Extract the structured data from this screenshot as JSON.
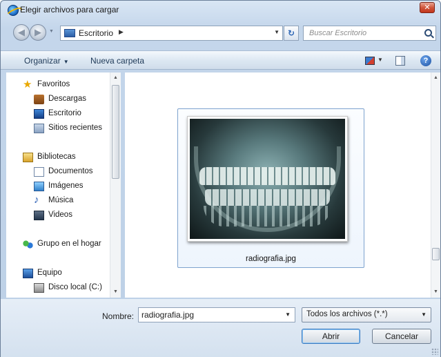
{
  "window": {
    "title": "Elegir archivos para cargar"
  },
  "address": {
    "location": "Escritorio"
  },
  "search": {
    "placeholder": "Buscar Escritorio"
  },
  "toolbar": {
    "organize_label": "Organizar",
    "new_folder_label": "Nueva carpeta"
  },
  "sidebar": {
    "items": [
      {
        "label": "Favoritos",
        "icon": "star-icon"
      },
      {
        "label": "Descargas",
        "icon": "downloads-icon"
      },
      {
        "label": "Escritorio",
        "icon": "desktop-icon"
      },
      {
        "label": "Sitios recientes",
        "icon": "recent-places-icon"
      },
      {
        "label": "Bibliotecas",
        "icon": "libraries-icon"
      },
      {
        "label": "Documentos",
        "icon": "documents-icon"
      },
      {
        "label": "Imágenes",
        "icon": "pictures-icon"
      },
      {
        "label": "Música",
        "icon": "music-icon"
      },
      {
        "label": "Videos",
        "icon": "videos-icon"
      },
      {
        "label": "Grupo en el hogar",
        "icon": "homegroup-icon"
      },
      {
        "label": "Equipo",
        "icon": "computer-icon"
      },
      {
        "label": "Disco local (C:)",
        "icon": "disk-icon"
      }
    ]
  },
  "files": [
    {
      "name": "radiografia.jpg",
      "icon": "xray-image-thumbnail"
    }
  ],
  "footer": {
    "filename_label": "Nombre:",
    "filename_value": "radiografia.jpg",
    "filter_value": "Todos los archivos (*.*)",
    "open_label": "Abrir",
    "cancel_label": "Cancelar"
  },
  "colors": {
    "close_button": "#c2361b",
    "selection_border": "#7da2ce",
    "accent": "#2a64b4"
  }
}
